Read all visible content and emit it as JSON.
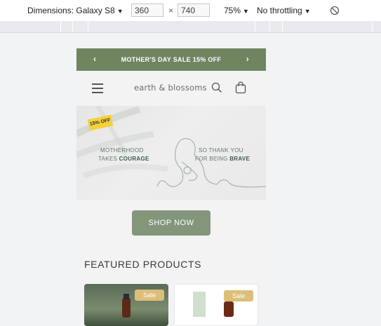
{
  "devtools": {
    "dimensions_label": "Dimensions: Galaxy S8",
    "width_value": "360",
    "times_symbol": "×",
    "height_value": "740",
    "zoom": "75%",
    "throttling": "No throttling",
    "caret": "▼"
  },
  "store": {
    "announcement": "MOTHER'S DAY SALE 15% OFF",
    "prev_arrow": "‹",
    "next_arrow": "›",
    "brand": "earth & blossoms",
    "banner": {
      "badge": "15% OFF",
      "left_line1": "MOTHERHOOD",
      "left_line2_plain": "TAKES ",
      "left_line2_bold": "COURAGE",
      "right_line1": "SO THANK YOU",
      "right_line2_plain": "FOR BEING ",
      "right_line2_bold": "BRAVE"
    },
    "cta": "SHOP NOW",
    "featured_title": "FEATURED PRODUCTS",
    "products": [
      {
        "badge": "Sale"
      },
      {
        "badge": "Sale"
      }
    ]
  },
  "colors": {
    "announcement_bg": "#6e8560",
    "cta_bg": "#84967a",
    "sale_badge": "#dcbf77",
    "promo_badge": "#f4d13a"
  }
}
